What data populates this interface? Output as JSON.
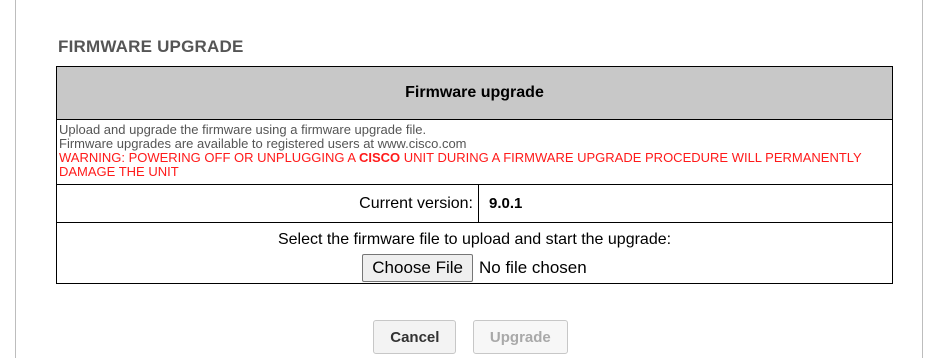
{
  "page": {
    "title": "FIRMWARE UPGRADE"
  },
  "section": {
    "header": "Firmware upgrade",
    "info_line1": "Upload and upgrade the firmware using a firmware upgrade file.",
    "info_line2": "Firmware upgrades are available to registered users at www.cisco.com",
    "warning_part1": "WARNING: POWERING OFF OR UNPLUGGING A ",
    "warning_brand": "CISCO",
    "warning_part2": " UNIT DURING A FIRMWARE UPGRADE PROCEDURE WILL PERMANENTLY DAMAGE THE UNIT",
    "version_label": "Current version:",
    "version_value": "9.0.1",
    "select_text": "Select the firmware file to upload and start the upgrade:",
    "choose_file_label": "Choose File",
    "file_status": "No file chosen"
  },
  "actions": {
    "cancel_label": "Cancel",
    "upgrade_label": "Upgrade"
  },
  "colors": {
    "header_bg": "#c8c8c8",
    "warning": "#ff1a1a",
    "title": "#555555",
    "disabled_text": "#a9a9a9"
  }
}
